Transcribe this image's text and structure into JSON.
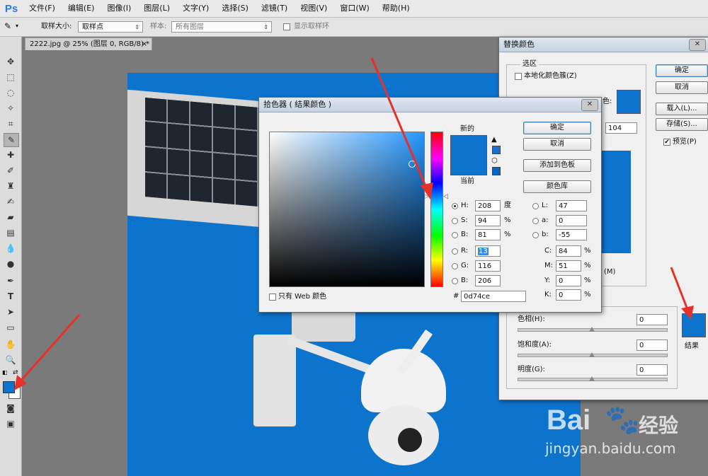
{
  "app": {
    "logo": "Ps",
    "menu": [
      "文件(F)",
      "编辑(E)",
      "图像(I)",
      "图层(L)",
      "文字(Y)",
      "选择(S)",
      "滤镜(T)",
      "视图(V)",
      "窗口(W)",
      "帮助(H)"
    ]
  },
  "options": {
    "sample_size_label": "取样大小:",
    "sample_size_value": "取样点",
    "sample_label": "样本:",
    "sample_value": "所有图层",
    "show_ring_label": "显示取样环"
  },
  "document": {
    "tab_title": "2222.jpg @ 25% (图层 0, RGB/8) *",
    "canvas_color": "#0d74ce"
  },
  "foreground_color": "#0d74ce",
  "background_color": "#ffffff",
  "replace_dialog": {
    "title": "替换颜色",
    "selection_group": "选区",
    "localized_clusters": "本地化颜色簇(Z)",
    "color_label_fragment": "色:",
    "fuzziness_value": "104",
    "image_label_fragment": "(M)",
    "ok": "确定",
    "cancel": "取消",
    "load": "载入(L)...",
    "save": "存储(S)...",
    "preview": "预览(P)",
    "hue_label": "色相(H):",
    "hue_value": "0",
    "saturation_label": "饱和度(A):",
    "saturation_value": "0",
    "lightness_label": "明度(G):",
    "lightness_value": "0",
    "result_label": "结果",
    "result_color": "#0d74ce"
  },
  "picker": {
    "title": "拾色器 ( 结果颜色 )",
    "new_label": "新的",
    "current_label": "当前",
    "new_color": "#0d74ce",
    "current_color": "#0d74ce",
    "ok": "确定",
    "cancel": "取消",
    "add_swatch": "添加到色板",
    "color_libraries": "颜色库",
    "hsb": {
      "h_label": "H:",
      "h": "208",
      "h_unit": "度",
      "s_label": "S:",
      "s": "94",
      "s_unit": "%",
      "b_label": "B:",
      "b": "81",
      "b_unit": "%"
    },
    "rgb": {
      "r_label": "R:",
      "r": "13",
      "g_label": "G:",
      "g": "116",
      "b_label": "B:",
      "b": "206"
    },
    "lab": {
      "l_label": "L:",
      "l": "47",
      "a_label": "a:",
      "a": "0",
      "b_label": "b:",
      "b": "-55"
    },
    "cmyk": {
      "c_label": "C:",
      "c": "84",
      "m_label": "M:",
      "m": "51",
      "y_label": "Y:",
      "y": "0",
      "k_label": "K:",
      "k": "0",
      "unit": "%"
    },
    "hex_label": "#",
    "hex": "0d74ce",
    "web_only": "只有 Web 颜色"
  },
  "watermark": {
    "brand": "Bai",
    "brand2": "经验",
    "url": "jingyan.baidu.com"
  }
}
